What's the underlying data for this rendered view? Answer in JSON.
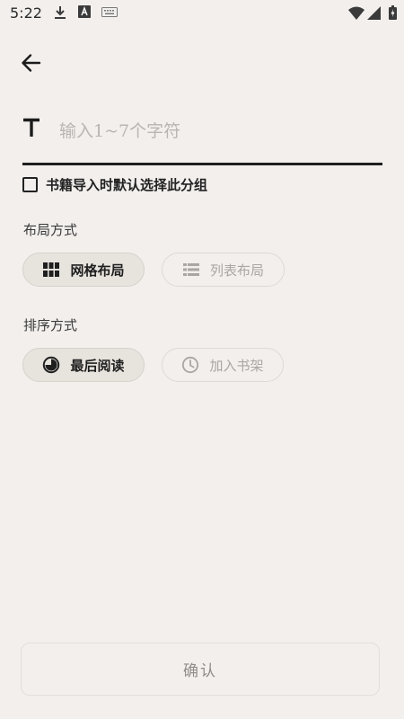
{
  "status_bar": {
    "time": "5:22",
    "icons": [
      "download-icon",
      "font-a-icon",
      "keyboard-icon",
      "wifi-icon",
      "signal-icon",
      "battery-icon"
    ]
  },
  "header": {
    "back_icon": "arrow-left-icon"
  },
  "name_field": {
    "icon": "text-t-icon",
    "value": "",
    "placeholder": "输入1~7个字符"
  },
  "default_group_checkbox": {
    "checked": false,
    "label": "书籍导入时默认选择此分组"
  },
  "layout_section": {
    "title": "布局方式",
    "options": [
      {
        "label": "网格布局",
        "icon": "grid-icon",
        "selected": true
      },
      {
        "label": "列表布局",
        "icon": "list-icon",
        "selected": false
      }
    ]
  },
  "sort_section": {
    "title": "排序方式",
    "options": [
      {
        "label": "最后阅读",
        "icon": "recent-read-icon",
        "selected": true
      },
      {
        "label": "加入书架",
        "icon": "clock-icon",
        "selected": false
      }
    ]
  },
  "confirm_button": {
    "label": "确认"
  },
  "colors": {
    "background": "#f2efed",
    "text": "#1c1c1c",
    "chip_selected_bg": "#e7e3dd",
    "muted": "#a9a6a3"
  }
}
